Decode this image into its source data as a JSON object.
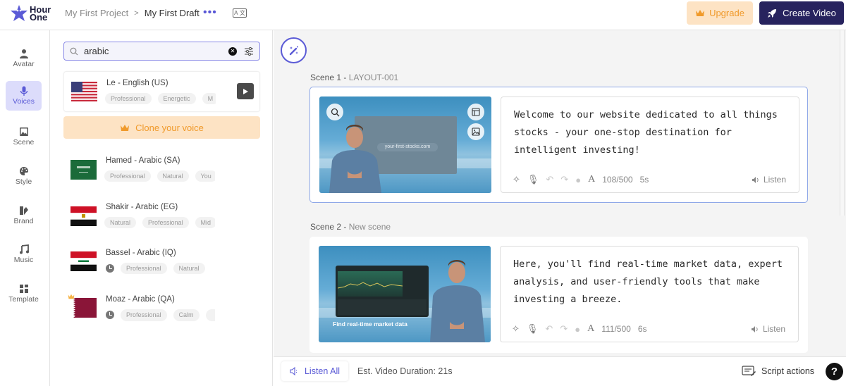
{
  "header": {
    "logo_text": [
      "Hour",
      "One"
    ],
    "breadcrumb": {
      "project": "My First Project",
      "separator": ">",
      "draft": "My First Draft"
    },
    "more_label": "•••",
    "upgrade_label": "Upgrade",
    "create_label": "Create Video"
  },
  "nav": {
    "items": [
      {
        "label": "Avatar",
        "icon": "person-icon",
        "active": false
      },
      {
        "label": "Voices",
        "icon": "microphone-icon",
        "active": true
      },
      {
        "label": "Scene",
        "icon": "image-icon",
        "active": false
      },
      {
        "label": "Style",
        "icon": "palette-icon",
        "active": false
      },
      {
        "label": "Brand",
        "icon": "brand-swatch-icon",
        "active": false
      },
      {
        "label": "Music",
        "icon": "music-note-icon",
        "active": false
      },
      {
        "label": "Template",
        "icon": "template-icon",
        "active": false
      }
    ]
  },
  "voices": {
    "search_value": "arabic",
    "clone_label": "Clone your voice",
    "selected": {
      "name": "Le - English (US)",
      "flag": "US",
      "tags": [
        "Professional",
        "Energetic",
        "M"
      ]
    },
    "list": [
      {
        "name": "Hamed - Arabic (SA)",
        "flag": "SA",
        "premium": false,
        "tags": [
          "Professional",
          "Natural",
          "You"
        ],
        "clock": false
      },
      {
        "name": "Shakir - Arabic (EG)",
        "flag": "EG",
        "premium": false,
        "tags": [
          "Natural",
          "Professional",
          "Mid"
        ],
        "clock": false
      },
      {
        "name": "Bassel - Arabic (IQ)",
        "flag": "IQ",
        "premium": false,
        "tags": [
          "Professional",
          "Natural"
        ],
        "clock": true
      },
      {
        "name": "Moaz - Arabic (QA)",
        "flag": "QA",
        "premium": true,
        "tags": [
          "Professional",
          "Calm",
          ""
        ],
        "clock": true
      }
    ]
  },
  "scenes": [
    {
      "number": "Scene 1 -",
      "name": "LAYOUT-001",
      "thumb_caption": "your-first-stocks.com",
      "script": "Welcome to our website dedicated to all things stocks - your one-stop destination for intelligent investing!",
      "char_count": "108/500",
      "duration": "5s",
      "listen_label": "Listen"
    },
    {
      "number": "Scene 2 -",
      "name": "New scene",
      "thumb_caption": "Find real-time market data",
      "script": "Here, you'll find real-time market data, expert analysis, and user-friendly tools that make investing a breeze.",
      "char_count": "111/500",
      "duration": "6s",
      "listen_label": "Listen"
    }
  ],
  "footer": {
    "listen_all_label": "Listen All",
    "duration_label": "Est. Video Duration: 21s",
    "script_actions_label": "Script actions",
    "help_label": "?"
  },
  "colors": {
    "accent": "#5b5bd6",
    "navy": "#27235e",
    "upgrade_bg": "#fde3c4",
    "upgrade_text": "#f09a2b"
  }
}
